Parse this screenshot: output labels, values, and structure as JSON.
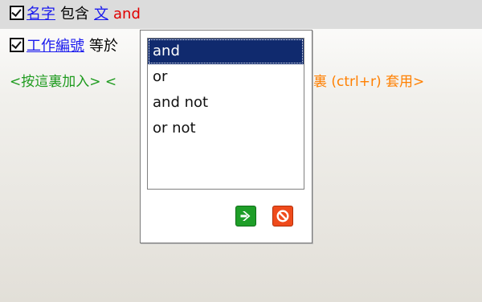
{
  "row1": {
    "field": "名字",
    "operator": "包含",
    "value": "文",
    "connector": "and"
  },
  "row2": {
    "field": "工作編號",
    "operator_partial": "等於"
  },
  "row3": {
    "add_text": "<按這裏加入>",
    "partial_open": "<",
    "apply_text": "裏 (ctrl+r) 套用>"
  },
  "popup": {
    "options": [
      "and",
      "or",
      "and not",
      "or not"
    ],
    "selected": "and"
  },
  "icons": {
    "ok": "arrow-right-icon",
    "cancel": "cancel-icon"
  },
  "colors": {
    "link": "#1a1aee",
    "connector": "#e00000",
    "hint_green": "#1e9b1e",
    "hint_orange": "#ff8000",
    "selection": "#102a6e"
  }
}
